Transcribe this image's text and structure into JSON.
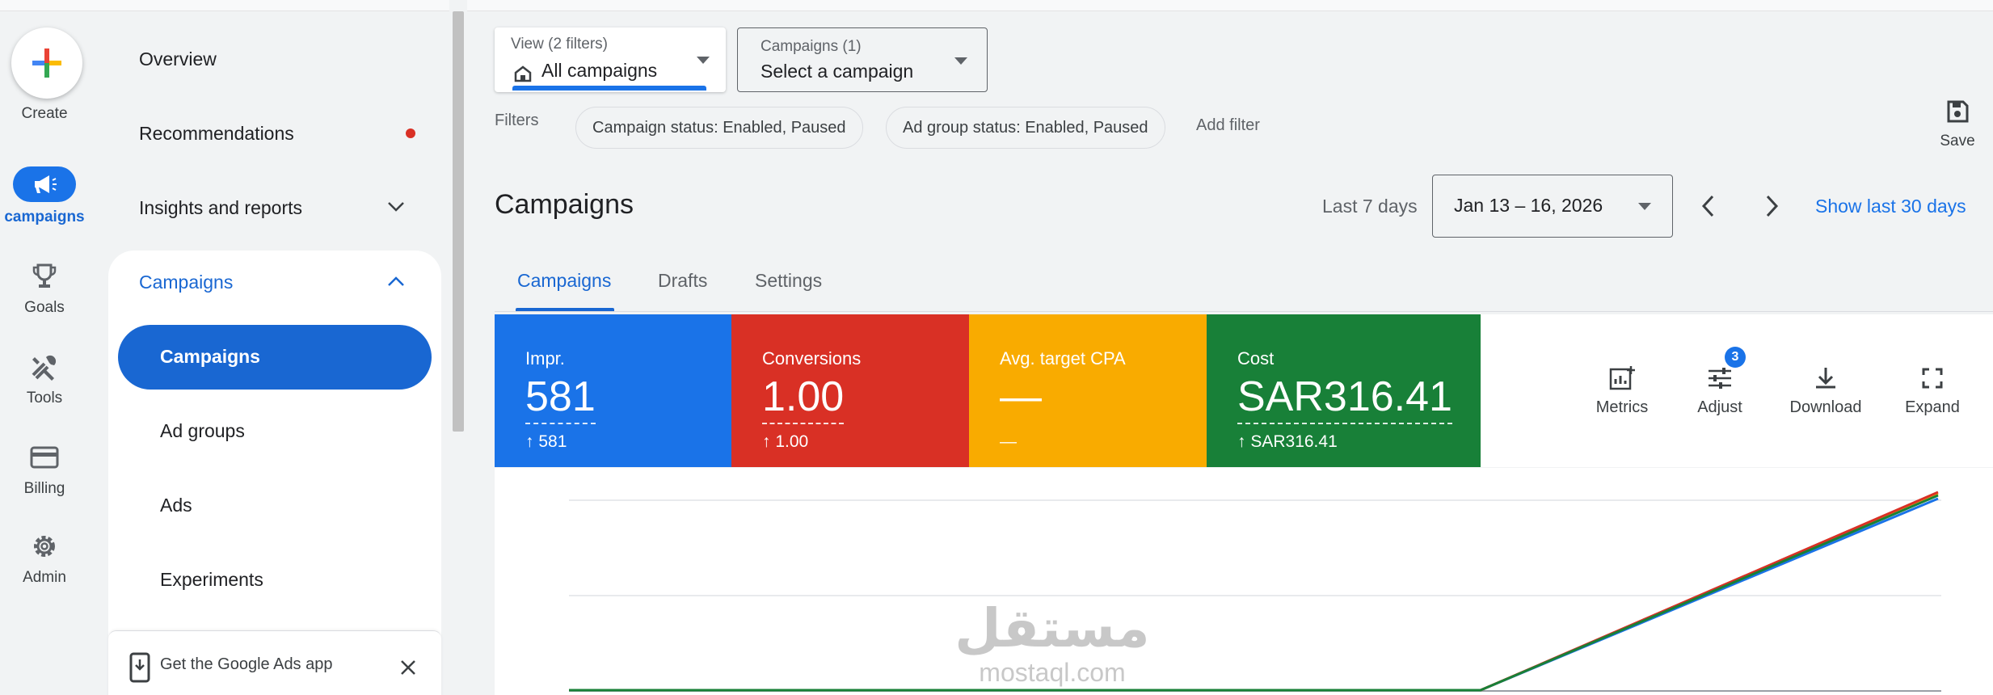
{
  "rail": {
    "create_label": "Create",
    "items": [
      {
        "label": "campaigns",
        "icon": "megaphone-icon",
        "active": true
      },
      {
        "label": "Goals",
        "icon": "trophy-icon"
      },
      {
        "label": "Tools",
        "icon": "tools-icon"
      },
      {
        "label": "Billing",
        "icon": "credit-card-icon"
      },
      {
        "label": "Admin",
        "icon": "gear-icon"
      }
    ]
  },
  "nav": {
    "overview": "Overview",
    "recommendations": "Recommendations",
    "insights": "Insights and reports",
    "campaigns_section": "Campaigns",
    "sub_items": [
      "Campaigns",
      "Ad groups",
      "Ads",
      "Experiments"
    ],
    "app_banner": "Get the Google Ads app"
  },
  "filters": {
    "view_caption": "View (2 filters)",
    "view_value": "All campaigns",
    "campaigns_caption": "Campaigns (1)",
    "campaigns_value": "Select a campaign",
    "filters_label": "Filters",
    "chips": [
      "Campaign status: Enabled, Paused",
      "Ad group status: Enabled, Paused"
    ],
    "add_filter": "Add filter",
    "save_label": "Save"
  },
  "page": {
    "title": "Campaigns",
    "range_label": "Last 7 days",
    "date_range": "Jan 13 – 16, 2026",
    "show_last_30": "Show last 30 days",
    "tabs": [
      "Campaigns",
      "Drafts",
      "Settings"
    ]
  },
  "metrics": [
    {
      "label": "Impr.",
      "value": "581",
      "delta": "581",
      "color": "#1a73e8"
    },
    {
      "label": "Conversions",
      "value": "1.00",
      "delta": "1.00",
      "color": "#d93025"
    },
    {
      "label": "Avg. target CPA",
      "value": "—",
      "delta": "—",
      "color": "#f9ab00"
    },
    {
      "label": "Cost",
      "value": "SAR316.41",
      "delta": "SAR316.41",
      "color": "#188038"
    }
  ],
  "tools": {
    "metrics": "Metrics",
    "adjust": "Adjust",
    "adjust_badge": "3",
    "download": "Download",
    "expand": "Expand"
  },
  "watermark": {
    "arabic": "مستقل",
    "latin": "mostaql.com"
  },
  "colors": {
    "accent": "#1a73e8",
    "nav_active": "#1967d2",
    "alert": "#d93025"
  }
}
